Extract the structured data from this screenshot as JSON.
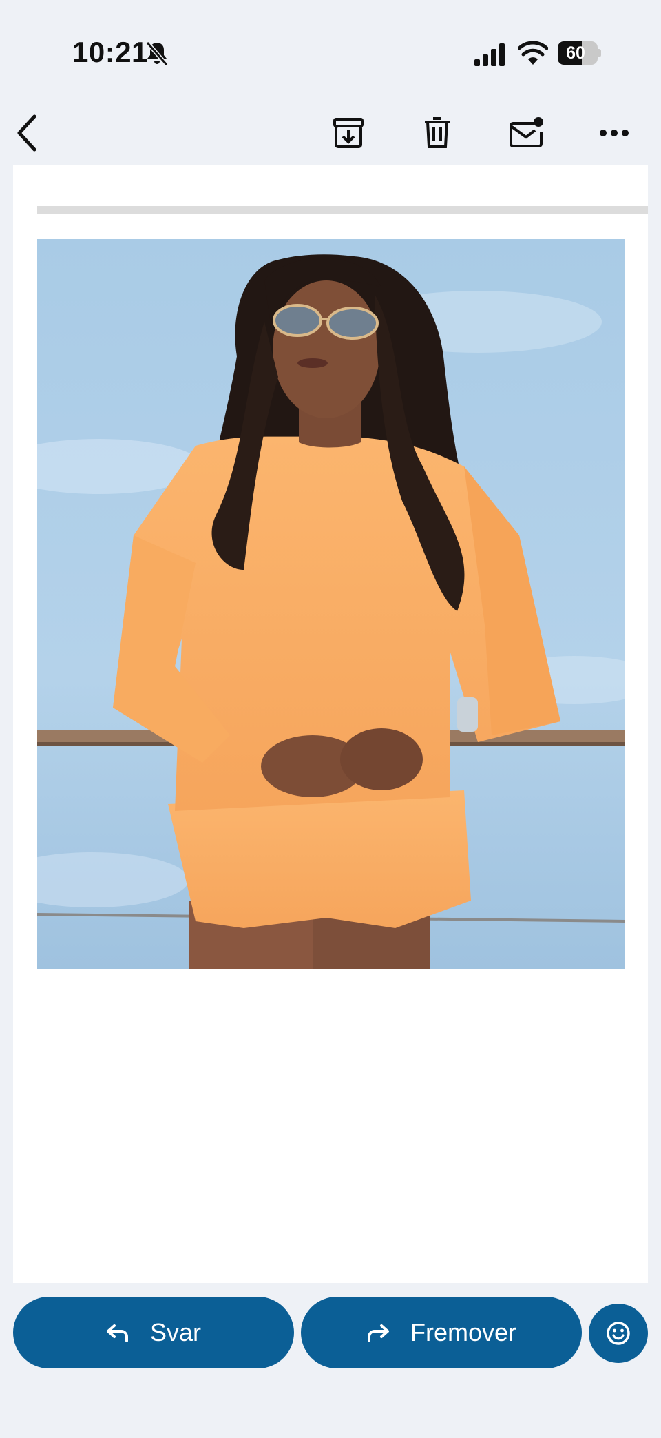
{
  "status_bar": {
    "time": "10:21",
    "battery_level": "60",
    "battery_fraction": 0.6,
    "icons": [
      "bell-slash-icon",
      "cellular-signal-icon",
      "wifi-icon",
      "battery-icon"
    ]
  },
  "toolbar": {
    "icons": [
      "back-arrow-icon",
      "archive-icon",
      "trash-icon",
      "mark-unread-icon",
      "more-options-icon"
    ]
  },
  "email": {
    "image": "photo"
  },
  "actions": {
    "reply_label": "Svar",
    "forward_label": "Fremover",
    "reply_icon": "reply-arrow-icon",
    "forward_icon": "forward-arrow-icon",
    "emoji_icon": "smiley-icon"
  },
  "colors": {
    "background": "#eef1f6",
    "card": "#ffffff",
    "action_button": "#0b5f96",
    "divider": "#dcdcdc"
  }
}
